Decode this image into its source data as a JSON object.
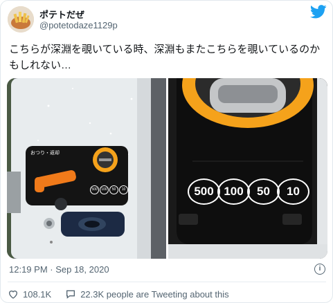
{
  "tweet": {
    "display_name": "ポテトだぜ",
    "handle": "@potetodaze1129p",
    "text": "こちらが深淵を覗いている時、深淵もまたこちらを覗いているのかもしれない…",
    "timestamp": "12:19 PM · Sep 18, 2020"
  },
  "media": {
    "left_photo": {
      "panel_label": "おつり・返却",
      "coin_labels": [
        "500",
        "100",
        "50",
        "10"
      ]
    },
    "right_photo": {
      "coin_labels": [
        "500",
        "100",
        "50",
        "10"
      ]
    }
  },
  "actions": {
    "likes": "108.1K",
    "talking": "22.3K people are Tweeting about this"
  },
  "icons": {
    "brand": "twitter-bird-icon",
    "info": "info-icon",
    "like": "heart-icon",
    "reply": "speech-bubble-icon"
  },
  "colors": {
    "brand": "#1da1f2",
    "text": "#0f1419",
    "secondary": "#536471",
    "coin_slot_orange": "#f5a21b"
  }
}
